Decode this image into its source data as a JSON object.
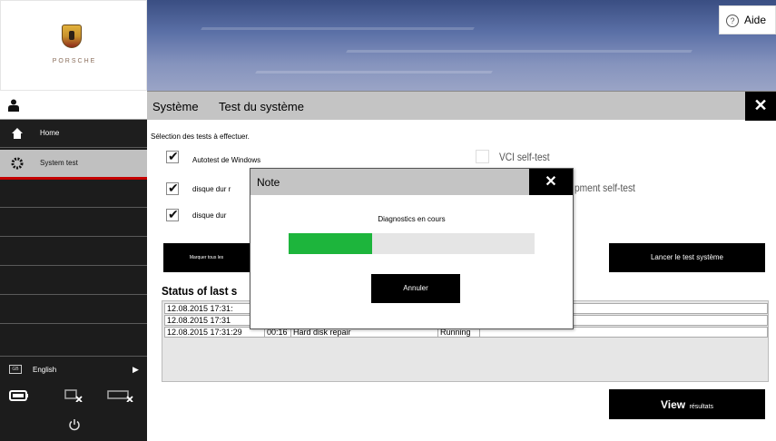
{
  "brand": {
    "wordmark": "PORSCHE"
  },
  "header": {
    "help_label": "Aide"
  },
  "title_bar": {
    "section": "Système",
    "page": "Test du système",
    "close_glyph": "✕"
  },
  "sidebar": {
    "items": [
      {
        "label": "Home",
        "icon": "home-icon"
      },
      {
        "label": "System test",
        "icon": "system-test-icon",
        "selected": true
      }
    ],
    "language": {
      "label": "English",
      "flag_code": "GB"
    }
  },
  "main": {
    "instruction": "Sélection des tests à effectuer.",
    "tests": [
      {
        "label": "Autotest de Windows",
        "checked": true
      },
      {
        "label": "disque dur r",
        "checked": true
      },
      {
        "label": "disque dur",
        "checked": true
      }
    ],
    "vci_label": "VCI self-test",
    "equipment_label": "pment self-test",
    "mark_all_label": "Marquer tous les",
    "launch_label": "Lancer le test système",
    "status_title": "Status of last s",
    "table_rows": [
      {
        "datetime": "12.08.2015 17:31:",
        "duration": "",
        "test": "",
        "status": ""
      },
      {
        "datetime": "12.08.2015 17:31",
        "duration": "",
        "test": "",
        "status": ""
      },
      {
        "datetime": "12.08.2015 17:31:29",
        "duration": "00:16",
        "test": "Hard disk repair",
        "status": "Running"
      }
    ],
    "view_label_big": "View",
    "view_label_small": "résultats"
  },
  "modal": {
    "title": "Note",
    "close_glyph": "✕",
    "message": "Diagnostics en cours",
    "progress": 0.34,
    "cancel_label": "Annuler"
  },
  "colors": {
    "accent_red": "#c50000",
    "progress_green": "#1db53c",
    "button_black": "#000000"
  }
}
